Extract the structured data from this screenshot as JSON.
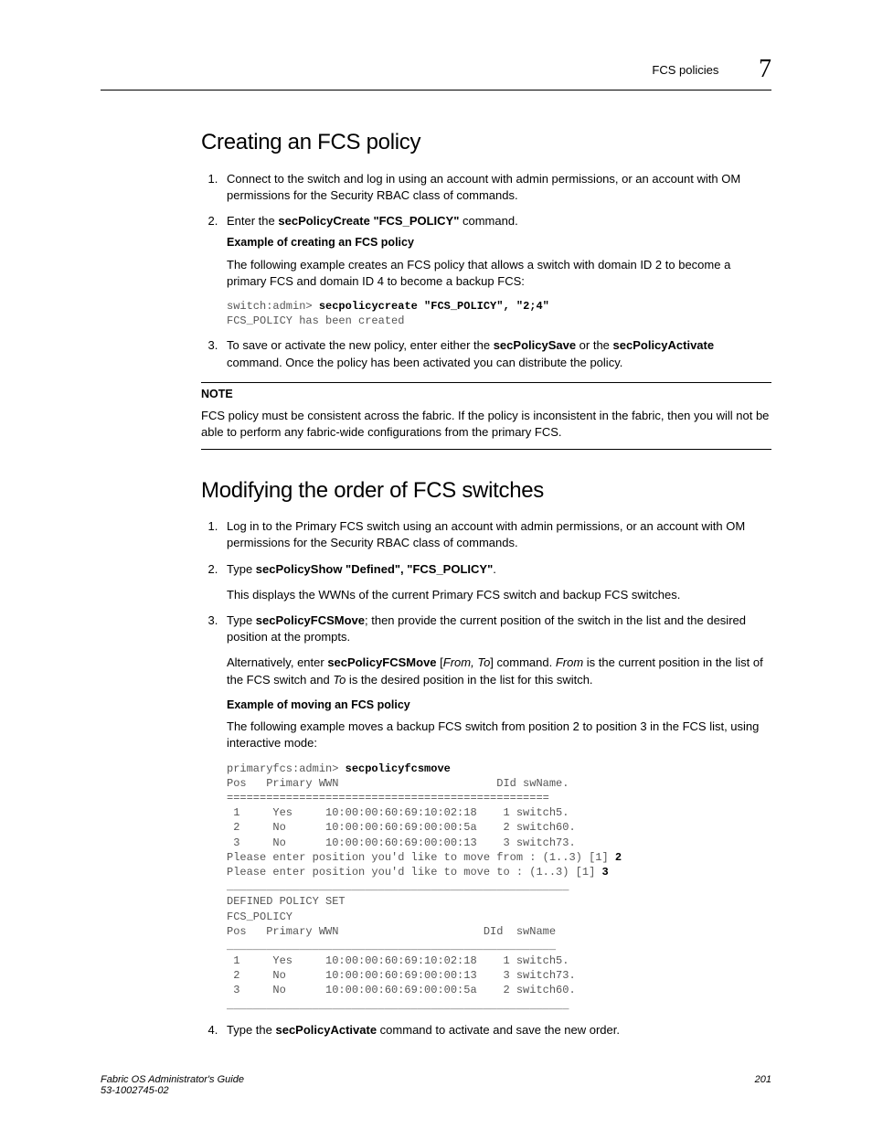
{
  "header": {
    "runningTitle": "FCS policies",
    "chapterNumber": "7"
  },
  "section1": {
    "title": "Creating an FCS policy",
    "step1": "Connect to the switch and log in using an account with admin permissions, or an account with OM permissions for the Security RBAC class of commands.",
    "step2_pre": "Enter the ",
    "step2_cmd": "secPolicyCreate \"FCS_POLICY\"",
    "step2_post": " command.",
    "example_heading": "Example of creating an FCS policy",
    "example_intro": "The following example creates an FCS policy that allows a switch with domain ID 2 to become a primary FCS and domain ID 4 to become a backup FCS:",
    "code_prompt": "switch:admin> ",
    "code_cmd": "secpolicycreate \"FCS_POLICY\", \"2;4\"",
    "code_out": "FCS_POLICY has been created",
    "step3_pre": "To save or activate the new policy, enter either the ",
    "step3_cmd1": "secPolicySave",
    "step3_mid": " or the ",
    "step3_cmd2": "secPolicyActivate",
    "step3_post": " command. Once the policy has been activated you can distribute the policy.",
    "note_label": "NOTE",
    "note_body": "FCS policy must be consistent across the fabric. If the policy is inconsistent in the fabric, then you will not be able to perform any fabric-wide configurations from the primary FCS."
  },
  "section2": {
    "title": "Modifying the order of FCS switches",
    "step1": "Log in to the Primary FCS switch using an account with admin permissions, or an account with OM permissions for the Security RBAC class of commands.",
    "step2_pre": "Type ",
    "step2_cmd": "secPolicyShow \"Defined\", \"FCS_POLICY\"",
    "step2_post": ".",
    "step2_desc": "This displays the WWNs of the current Primary FCS switch and backup FCS switches.",
    "step3_pre": "Type ",
    "step3_cmd": "secPolicyFCSMove",
    "step3_post": "; then provide the current position of the switch in the list and the desired position at the prompts.",
    "step3_alt_pre": "Alternatively, enter ",
    "step3_alt_cmd": "secPolicyFCSMove",
    "step3_alt_mid1": " [",
    "step3_alt_args": "From, To",
    "step3_alt_mid2": "] command. ",
    "step3_alt_from": "From",
    "step3_alt_mid3": " is the current position in the list of the FCS switch and ",
    "step3_alt_to": "To",
    "step3_alt_mid4": " is the desired position in the list for this switch.",
    "example_heading": "Example of moving an FCS policy",
    "example_intro": "The following example moves a backup FCS switch from position 2 to position 3 in the FCS list, using interactive mode:",
    "code_prompt": "primaryfcs:admin> ",
    "code_cmd": "secpolicyfcsmove",
    "code_body_1": "Pos   Primary WWN                        DId swName.\n=================================================\n 1     Yes     10:00:00:60:69:10:02:18    1 switch5.\n 2     No      10:00:00:60:69:00:00:5a    2 switch60.\n 3     No      10:00:00:60:69:00:00:13    3 switch73.\nPlease enter position you'd like to move from : (1..3) [1] ",
    "code_input_1": "2",
    "code_body_2": "Please enter position you'd like to move to : (1..3) [1] ",
    "code_input_2": "3",
    "code_body_3": "____________________________________________________\nDEFINED POLICY SET\nFCS_POLICY\nPos   Primary WWN                      DId  swName\n__________________________________________________\n 1     Yes     10:00:00:60:69:10:02:18    1 switch5.\n 2     No      10:00:00:60:69:00:00:13    3 switch73.\n 3     No      10:00:00:60:69:00:00:5a    2 switch60.\n____________________________________________________",
    "step4_pre": "Type the ",
    "step4_cmd": "secPolicyActivate",
    "step4_post": " command to activate and save the new order."
  },
  "footer": {
    "bookTitle": "Fabric OS Administrator's Guide",
    "docNumber": "53-1002745-02",
    "pageNumber": "201"
  }
}
